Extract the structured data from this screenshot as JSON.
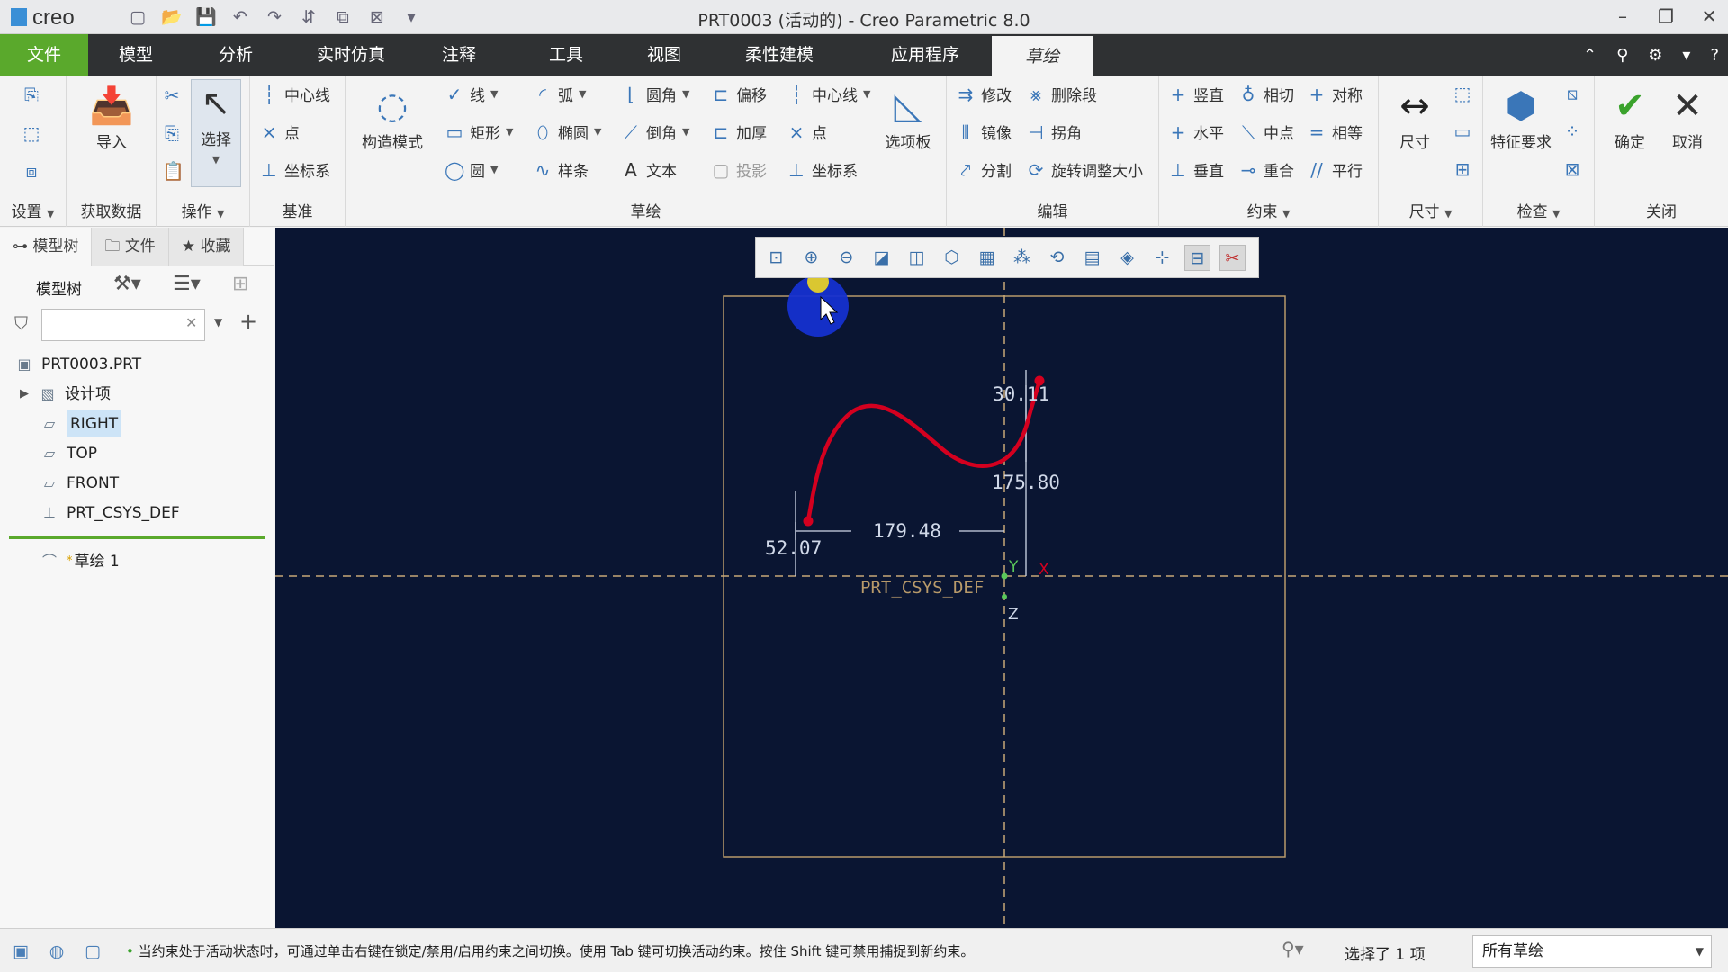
{
  "titlebar": {
    "brand": "creo",
    "title": "PRT0003 (活动的) - Creo Parametric 8.0"
  },
  "tabs": [
    {
      "label": "文件"
    },
    {
      "label": "模型"
    },
    {
      "label": "分析"
    },
    {
      "label": "实时仿真"
    },
    {
      "label": "注释"
    },
    {
      "label": "工具"
    },
    {
      "label": "视图"
    },
    {
      "label": "柔性建模"
    },
    {
      "label": "应用程序"
    },
    {
      "label": "草绘"
    }
  ],
  "ribbon": {
    "settings_label": "设置",
    "getdata": {
      "import": "导入",
      "label": "获取数据"
    },
    "operations": {
      "select": "选择",
      "label": "操作"
    },
    "datum": {
      "centerline": "中心线",
      "point": "点",
      "csys": "坐标系",
      "label": "基准"
    },
    "sketch": {
      "construct_mode": "构造模式",
      "line": "线",
      "arc": "弧",
      "fillet": "圆角",
      "offset": "偏移",
      "centerline": "中心线",
      "rect": "矩形",
      "ellipse": "椭圆",
      "chamfer": "倒角",
      "thicken": "加厚",
      "point": "点",
      "circle": "圆",
      "spline": "样条",
      "text": "文本",
      "project": "投影",
      "csys": "坐标系",
      "palette": "选项板",
      "label": "草绘"
    },
    "edit": {
      "modify": "修改",
      "delete_seg": "删除段",
      "mirror": "镜像",
      "corner": "拐角",
      "divide": "分割",
      "rotate_resize": "旋转调整大小",
      "label": "编辑"
    },
    "constrain": {
      "vertical": "竖直",
      "tangent": "相切",
      "symmetric": "对称",
      "horizontal": "水平",
      "midpoint": "中点",
      "equal": "相等",
      "perpendicular": "垂直",
      "coincident": "重合",
      "parallel": "平行",
      "label": "约束"
    },
    "dimension": {
      "dim": "尺寸",
      "label": "尺寸"
    },
    "inspect": {
      "feature_req": "特征要求",
      "label": "检查"
    },
    "close": {
      "ok": "确定",
      "cancel": "取消",
      "label": "关闭"
    }
  },
  "panel": {
    "tabs": [
      "模型树",
      "文件",
      "收藏"
    ],
    "tree_label": "模型树",
    "search_value": "",
    "items": [
      {
        "label": "PRT0003.PRT"
      },
      {
        "label": "设计项"
      },
      {
        "label": "RIGHT"
      },
      {
        "label": "TOP"
      },
      {
        "label": "FRONT"
      },
      {
        "label": "PRT_CSYS_DEF"
      },
      {
        "label": "草绘 1"
      }
    ]
  },
  "sketch": {
    "dims": {
      "d1": "30.11",
      "d2": "175.80",
      "d3": "179.48",
      "d4": "52.07"
    },
    "axis_x": "X",
    "axis_y": "Y",
    "axis_z": "Z",
    "csys_label": "PRT_CSYS_DEF",
    "colors": {
      "background": "#0a1532",
      "spline": "#d4001f",
      "dimension": "#d0d8e8",
      "frame": "#b89a6a",
      "axis": "#c8a878"
    }
  },
  "status": {
    "message": "当约束处于活动状态时，可通过单击右键在锁定/禁用/启用约束之间切换。使用 Tab 键可切换活动约束。按住 Shift 键可禁用捕捉到新约束。",
    "selected": "选择了 1 项",
    "filter": "所有草绘"
  }
}
